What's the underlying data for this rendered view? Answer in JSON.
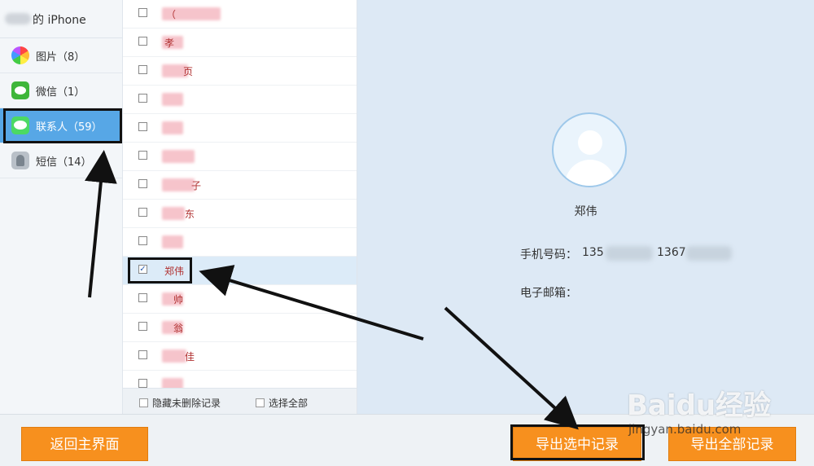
{
  "device": {
    "title": "的 iPhone"
  },
  "sidebar": {
    "items": [
      {
        "label": "图片（8）",
        "icon": "photos-icon"
      },
      {
        "label": "微信（1）",
        "icon": "wechat-icon"
      },
      {
        "label": "联系人（59）",
        "icon": "contacts-icon"
      },
      {
        "label": "短信（14）",
        "icon": "sms-icon"
      }
    ]
  },
  "contacts": {
    "rows": [
      {
        "name": "（",
        "checked": false
      },
      {
        "name": "孝",
        "checked": false
      },
      {
        "name": "页",
        "checked": false
      },
      {
        "name": "",
        "checked": false
      },
      {
        "name": "",
        "checked": false
      },
      {
        "name": "",
        "checked": false
      },
      {
        "name": "子",
        "checked": false
      },
      {
        "name": "东",
        "checked": false
      },
      {
        "name": "",
        "checked": false
      },
      {
        "name": "郑伟",
        "checked": true
      },
      {
        "name": "帅",
        "checked": false
      },
      {
        "name": "翁",
        "checked": false
      },
      {
        "name": "佳",
        "checked": false
      },
      {
        "name": "",
        "checked": false
      }
    ],
    "footer": {
      "hide_deleted_label": "隐藏未删除记录",
      "select_all_label": "选择全部"
    }
  },
  "detail": {
    "name": "郑伟",
    "phone_label": "手机号码：",
    "phone_1_prefix": "135",
    "phone_2_prefix": "1367",
    "email_label": "电子邮箱："
  },
  "buttons": {
    "back": "返回主界面",
    "export_selected": "导出选中记录",
    "export_all": "导出全部记录"
  },
  "watermark": {
    "brand": "Baidu经验",
    "url": "jingyan.baidu.com"
  },
  "colors": {
    "accent_orange": "#f7901e",
    "sidebar_active": "#57a7e6",
    "detail_bg": "#dde9f5",
    "name_red": "#b03030"
  }
}
